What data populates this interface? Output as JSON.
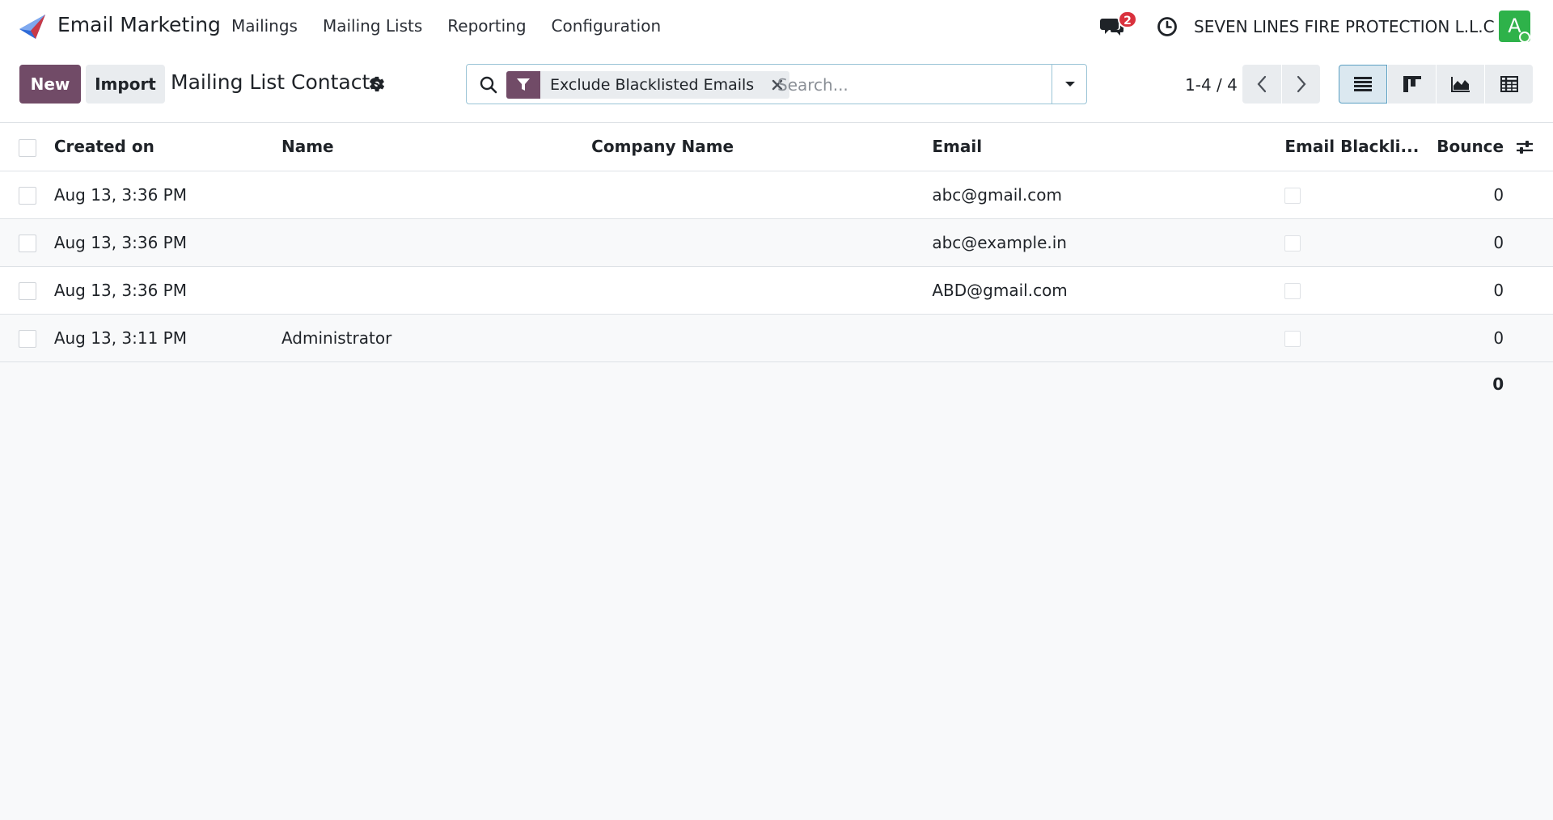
{
  "navbar": {
    "app_name": "Email Marketing",
    "menu": [
      "Mailings",
      "Mailing Lists",
      "Reporting",
      "Configuration"
    ],
    "chat_badge": "2",
    "company": "SEVEN LINES FIRE PROTECTION L.L.C",
    "avatar_letter": "A",
    "avatar_color": "#2eb24a"
  },
  "control_panel": {
    "new_label": "New",
    "import_label": "Import",
    "title": "Mailing List Contacts",
    "search": {
      "facet_label": "Exclude Blacklisted Emails",
      "placeholder": "Search..."
    },
    "pager": "1-4 / 4",
    "primary_color": "#714b67"
  },
  "table": {
    "columns": [
      "Created on",
      "Name",
      "Company Name",
      "Email",
      "Email Blackli...",
      "Bounce"
    ],
    "rows": [
      {
        "created_on": "Aug 13, 3:36 PM",
        "name": "",
        "company": "",
        "email": "abc@gmail.com",
        "blacklisted": false,
        "bounce": "0"
      },
      {
        "created_on": "Aug 13, 3:36 PM",
        "name": "",
        "company": "",
        "email": "abc@example.in",
        "blacklisted": false,
        "bounce": "0"
      },
      {
        "created_on": "Aug 13, 3:36 PM",
        "name": "",
        "company": "",
        "email": "ABD@gmail.com",
        "blacklisted": false,
        "bounce": "0"
      },
      {
        "created_on": "Aug 13, 3:11 PM",
        "name": "Administrator",
        "company": "",
        "email": "",
        "blacklisted": false,
        "bounce": "0"
      }
    ],
    "bounce_total": "0"
  }
}
